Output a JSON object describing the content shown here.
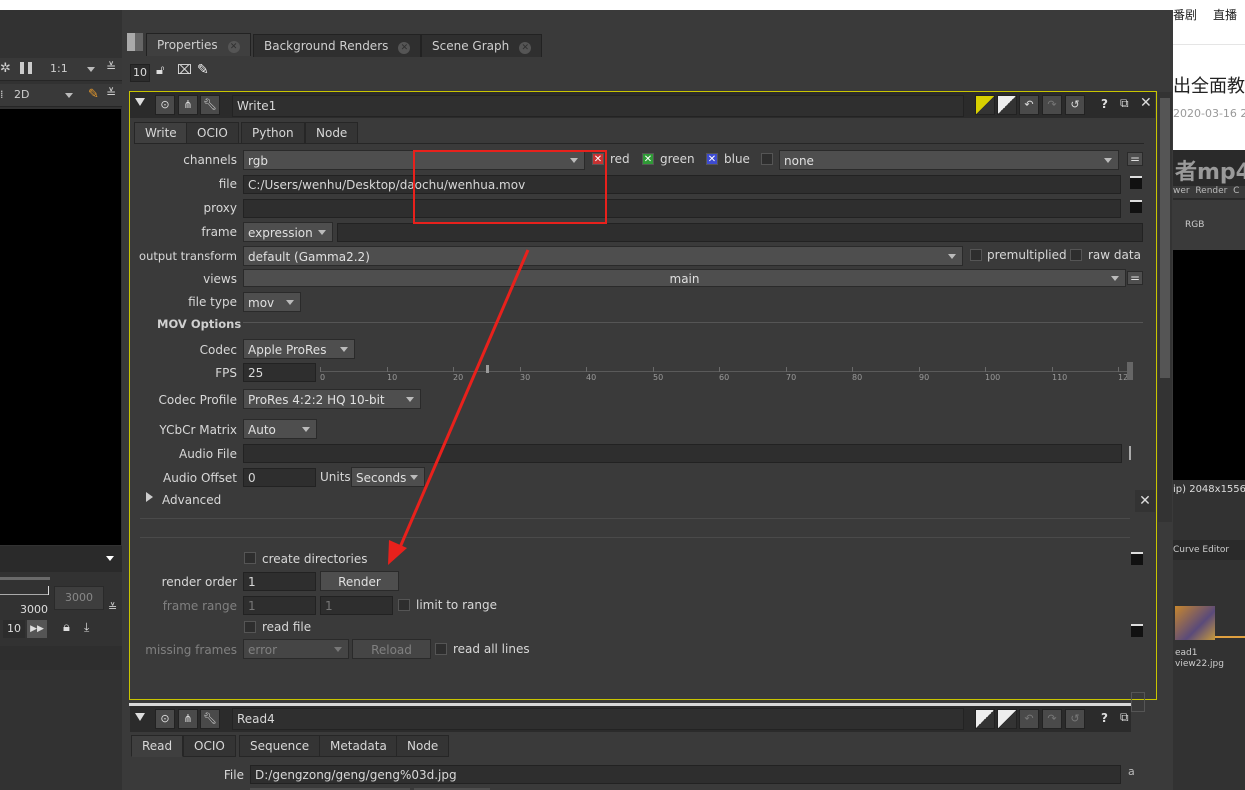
{
  "top_tabs": [
    {
      "label": "Properties",
      "active": true
    },
    {
      "label": "Background Renders",
      "active": false
    },
    {
      "label": "Scene Graph",
      "active": false
    }
  ],
  "toolbar": {
    "max_panels": "10"
  },
  "left_panel": {
    "zoom": "1:1",
    "view_mode": "2D",
    "frame_end": "3000",
    "frame_end_box": "3000",
    "frame_step": "10"
  },
  "web": {
    "nav1": "番剧",
    "nav2": "直播",
    "title_fragment": "出全面教",
    "date_fragment": "2020-03-16 2",
    "banner_text": "者mp4",
    "menu_fragment": "wer  Render  C",
    "rgb": "RGB",
    "res": "ip) 2048x1556",
    "curve_editor": "Curve Editor",
    "node_label1": "ead1",
    "node_label2": "view22.jpg"
  },
  "write_node": {
    "name": "Write1",
    "tabs": [
      "Write",
      "OCIO",
      "Python",
      "Node"
    ],
    "channels": {
      "label": "channels",
      "value": "rgb",
      "red": "red",
      "green": "green",
      "blue": "blue",
      "alpha": "none"
    },
    "file": {
      "label": "file",
      "value": "C:/Users/wenhu/Desktop/daochu/wenhua.mov"
    },
    "proxy": {
      "label": "proxy",
      "value": ""
    },
    "frame": {
      "label": "frame",
      "mode": "expression",
      "value": ""
    },
    "output_transform": {
      "label": "output transform",
      "value": "default (Gamma2.2)",
      "premultiplied": "premultiplied",
      "raw_data": "raw data"
    },
    "views": {
      "label": "views",
      "value": "main"
    },
    "file_type": {
      "label": "file type",
      "value": "mov"
    },
    "mov_options": {
      "heading": "MOV Options",
      "codec_label": "Codec",
      "codec": "Apple ProRes",
      "fps_label": "FPS",
      "fps": "25",
      "fps_ticks": [
        "0",
        "10",
        "20",
        "30",
        "40",
        "50",
        "60",
        "70",
        "80",
        "90",
        "100",
        "110",
        "120"
      ],
      "fps_fraction": 0.208,
      "profile_label": "Codec Profile",
      "profile": "ProRes 4:2:2 HQ 10-bit",
      "matrix_label": "YCbCr Matrix",
      "matrix": "Auto",
      "audio_file_label": "Audio File",
      "audio_file": "",
      "audio_offset_label": "Audio Offset",
      "audio_offset": "0",
      "units_label": "Units",
      "units": "Seconds",
      "advanced": "Advanced"
    },
    "create_directories": "create directories",
    "render_order_label": "render order",
    "render_order": "1",
    "render_button": "Render",
    "frame_range_label": "frame range",
    "frame_range_start": "1",
    "frame_range_end": "1",
    "limit_to_range": "limit to range",
    "read_file": "read file",
    "missing_frames_label": "missing frames",
    "missing_frames": "error",
    "reload_button": "Reload",
    "read_all_lines": "read all lines"
  },
  "read_node": {
    "name": "Read4",
    "tabs": [
      "Read",
      "OCIO",
      "Sequence",
      "Metadata",
      "Node"
    ],
    "file_label": "File",
    "file": "D:/gengzong/geng/geng%03d.jpg"
  },
  "colors": {
    "annotation": "#e8211c",
    "node_outline": "#c9c500"
  }
}
